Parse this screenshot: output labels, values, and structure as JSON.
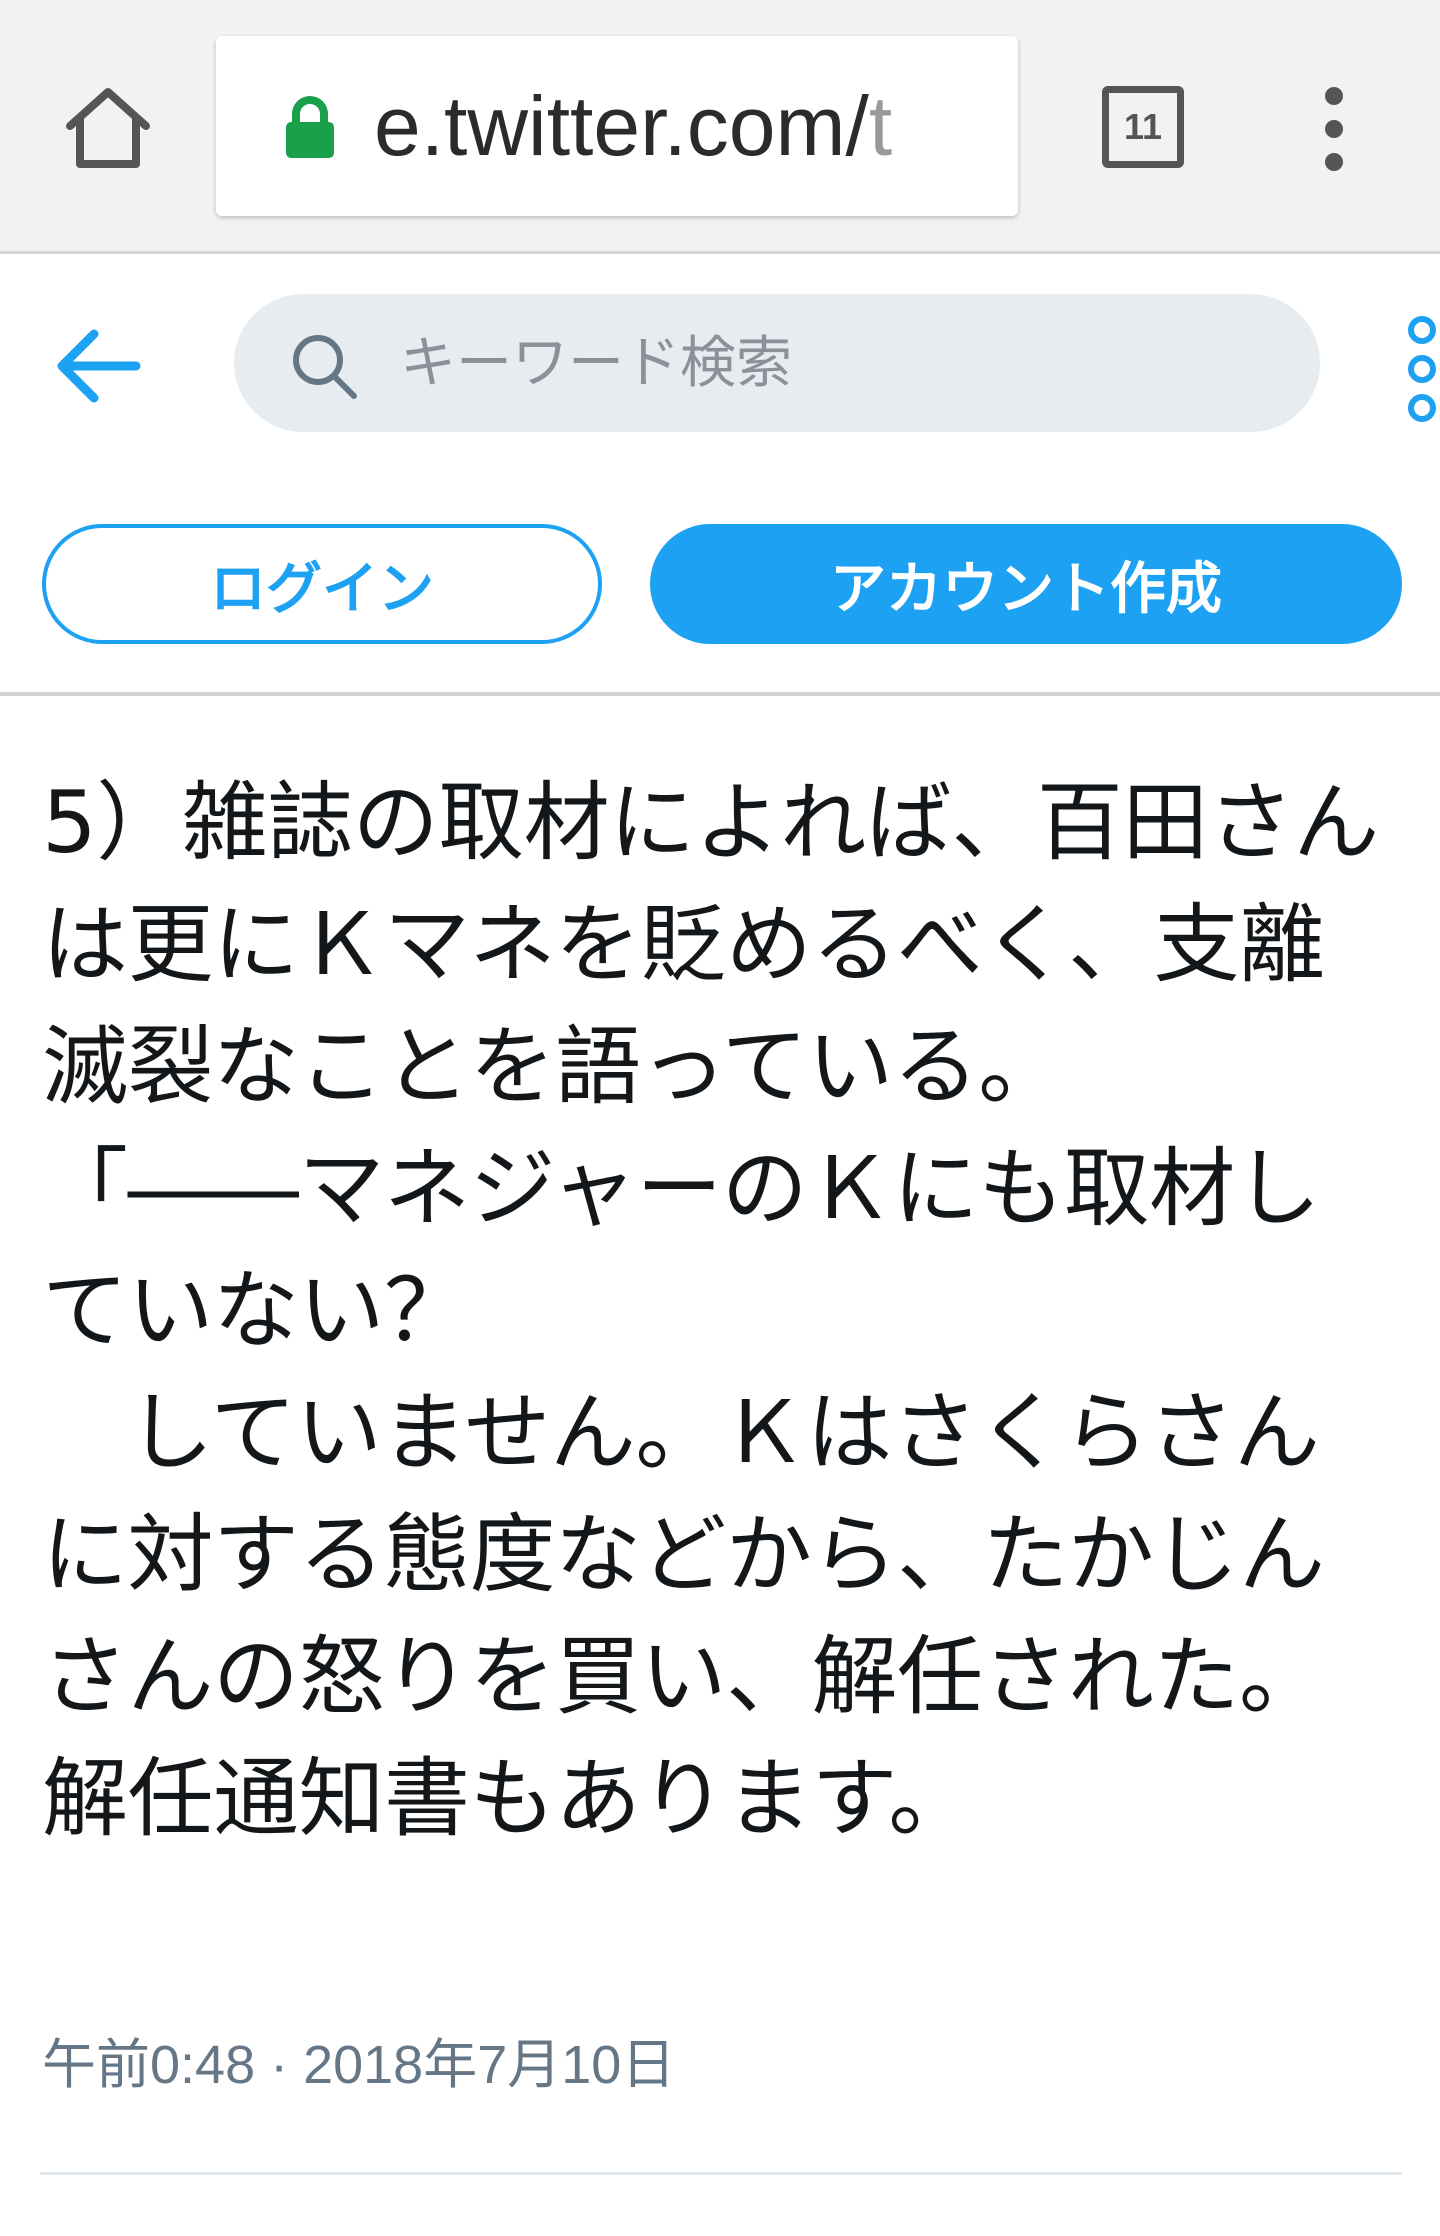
{
  "browser": {
    "url_host": "e.twitter.com/",
    "url_rest": "t",
    "tab_count": "11",
    "icons": {
      "home": "home-icon",
      "lock": "lock-icon",
      "tabs": "tabs-icon",
      "menu": "kebab-menu-icon"
    },
    "colors": {
      "lock": "#1a9f4b",
      "chrome_bg": "#f2f2f2"
    }
  },
  "header": {
    "search_placeholder": "キーワード検索",
    "icons": {
      "back": "arrow-left-icon",
      "search": "search-icon",
      "more": "more-vertical-icon"
    },
    "accent_color": "#1da1f2"
  },
  "auth": {
    "login_label": "ログイン",
    "signup_label": "アカウント作成"
  },
  "tweet": {
    "text": "5）雑誌の取材によれば、百田さんは更にＫマネを貶めるべく、支離滅裂なことを語っている。\n「――マネジャーのＫにも取材していない？\n　していません。Ｋはさくらさんに対する態度などから、たかじんさんの怒りを買い、解任された。解任通知書もあります。",
    "timestamp": "午前0:48 · 2018年7月10日"
  }
}
